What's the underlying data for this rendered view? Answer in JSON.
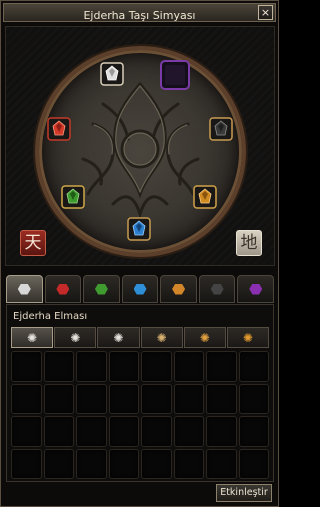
{
  "window": {
    "title": "Ejderha Taşı Simyası",
    "close_glyph": "×"
  },
  "altar": {
    "heaven_char": "天",
    "earth_char": "地",
    "slots": [
      {
        "name": "slot-top",
        "color": "#c8c8c8",
        "icon": "diamond-gem-icon"
      },
      {
        "name": "slot-top-right",
        "color": "#6a2f8f",
        "icon": "empty-purple-slot-icon"
      },
      {
        "name": "slot-left",
        "color": "#d23a2a",
        "icon": "ruby-gem-icon"
      },
      {
        "name": "slot-right",
        "color": "#3a3a3a",
        "icon": "onyx-gem-icon"
      },
      {
        "name": "slot-bottom-left",
        "color": "#3f9a2f",
        "icon": "jade-gem-icon"
      },
      {
        "name": "slot-bottom-right",
        "color": "#d08b20",
        "icon": "garnet-gem-icon"
      },
      {
        "name": "slot-bottom",
        "color": "#2d7fd0",
        "icon": "sapphire-gem-icon"
      }
    ]
  },
  "tabs": [
    {
      "name": "tab-diamond",
      "color": "#d8d8d8",
      "active": true
    },
    {
      "name": "tab-ruby",
      "color": "#c42a2a",
      "active": false
    },
    {
      "name": "tab-jade",
      "color": "#3f9a2f",
      "active": false
    },
    {
      "name": "tab-sapphire",
      "color": "#2f8fd6",
      "active": false
    },
    {
      "name": "tab-garnet",
      "color": "#d2862a",
      "active": false
    },
    {
      "name": "tab-onyx",
      "color": "#444444",
      "active": false
    },
    {
      "name": "tab-amethyst",
      "color": "#8a2fb0",
      "active": false
    }
  ],
  "list": {
    "section_label": "Ejderha Elması",
    "variants": [
      {
        "glyph": "✺",
        "selected": true
      },
      {
        "glyph": "✺",
        "selected": false
      },
      {
        "glyph": "✺",
        "selected": false
      },
      {
        "glyph": "✺",
        "selected": false
      },
      {
        "glyph": "✺",
        "selected": false
      },
      {
        "glyph": "✺",
        "selected": false
      }
    ],
    "slot_count": 32
  },
  "actions": {
    "activate_label": "Etkinleştir"
  }
}
